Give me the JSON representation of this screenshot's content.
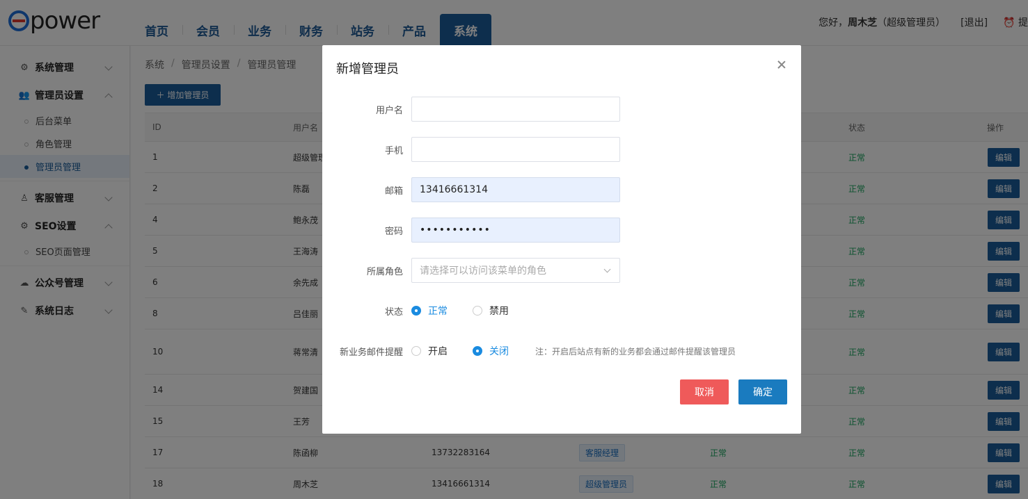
{
  "logo": {
    "text": "power"
  },
  "nav": [
    "首页",
    "会员",
    "业务",
    "财务",
    "站务",
    "产品",
    "系统"
  ],
  "user": {
    "greeting_prefix": "您好，",
    "name": "周木芝",
    "role": "（超级管理员）",
    "logout": "[退出]",
    "extra": "⏰ 提"
  },
  "sidebar": {
    "groups": [
      {
        "title": "系统管理",
        "icon": "gears-icon",
        "expanded": false,
        "items": []
      },
      {
        "title": "管理员设置",
        "icon": "users-icon",
        "expanded": true,
        "items": [
          "后台菜单",
          "角色管理",
          "管理员管理"
        ]
      },
      {
        "title": "客服管理",
        "icon": "support-icon",
        "expanded": false,
        "items": []
      },
      {
        "title": "SEO设置",
        "icon": "gear-icon",
        "expanded": true,
        "items": [
          "SEO页面管理"
        ]
      },
      {
        "title": "公众号管理",
        "icon": "wechat-icon",
        "expanded": false,
        "items": []
      },
      {
        "title": "系统日志",
        "icon": "log-icon",
        "expanded": false,
        "items": []
      }
    ]
  },
  "breadcrumb": [
    "系统",
    "管理员设置",
    "管理员管理"
  ],
  "add_button": "＋ 增加管理员",
  "table": {
    "headers": [
      "ID",
      "用户名",
      "",
      "",
      "",
      "状态",
      "操作"
    ],
    "rows": [
      {
        "id": "1",
        "name": "超级管理",
        "phone": "",
        "role": "",
        "mail": "",
        "state": "正常"
      },
      {
        "id": "2",
        "name": "陈磊",
        "phone": "",
        "role": "",
        "mail": "",
        "state": "正常"
      },
      {
        "id": "4",
        "name": "鲍永茂",
        "phone": "",
        "role": "",
        "mail": "",
        "state": "正常"
      },
      {
        "id": "5",
        "name": "王海涛",
        "phone": "",
        "role": "",
        "mail": "",
        "state": "正常"
      },
      {
        "id": "6",
        "name": "余先成",
        "phone": "",
        "role": "",
        "mail": "",
        "state": "正常"
      },
      {
        "id": "8",
        "name": "吕佳丽",
        "phone": "",
        "role": "",
        "mail": "",
        "state": "正常"
      },
      {
        "id": "10",
        "name": "蒋常清",
        "phone": "",
        "role": "",
        "mail": "",
        "state": "正常"
      },
      {
        "id": "14",
        "name": "贺建国",
        "phone": "",
        "role": "",
        "mail": "",
        "state": "正常"
      },
      {
        "id": "15",
        "name": "王芳",
        "phone": "",
        "role": "",
        "mail": "",
        "state": "正常"
      },
      {
        "id": "17",
        "name": "陈函柳",
        "phone": "13732283164",
        "role": "客服经理",
        "mail": "正常",
        "state": "正常"
      },
      {
        "id": "18",
        "name": "周木芝",
        "phone": "13416661314",
        "role": "超级管理员",
        "mail": "正常",
        "state": "正常"
      }
    ],
    "edit_label": "编辑"
  },
  "modal": {
    "title": "新增管理员",
    "fields": {
      "username": {
        "label": "用户名",
        "value": ""
      },
      "phone": {
        "label": "手机",
        "value": ""
      },
      "email": {
        "label": "邮箱",
        "value": "13416661314"
      },
      "password": {
        "label": "密码",
        "value": "•••••••••••"
      },
      "role": {
        "label": "所属角色",
        "placeholder": "请选择可以访问该菜单的角色"
      }
    },
    "status": {
      "label": "状态",
      "options": [
        "正常",
        "禁用"
      ],
      "selected": "正常"
    },
    "mail_notify": {
      "label": "新业务邮件提醒",
      "options": [
        "开启",
        "关闭"
      ],
      "selected": "关闭",
      "hint": "注：开启后站点有新的业务都会通过邮件提醒该管理员"
    },
    "cancel": "取消",
    "confirm": "确定"
  },
  "colors": {
    "primary": "#1a5d9a",
    "accent": "#1a8be0",
    "danger": "#ef5a5a",
    "success": "#19a55f"
  }
}
